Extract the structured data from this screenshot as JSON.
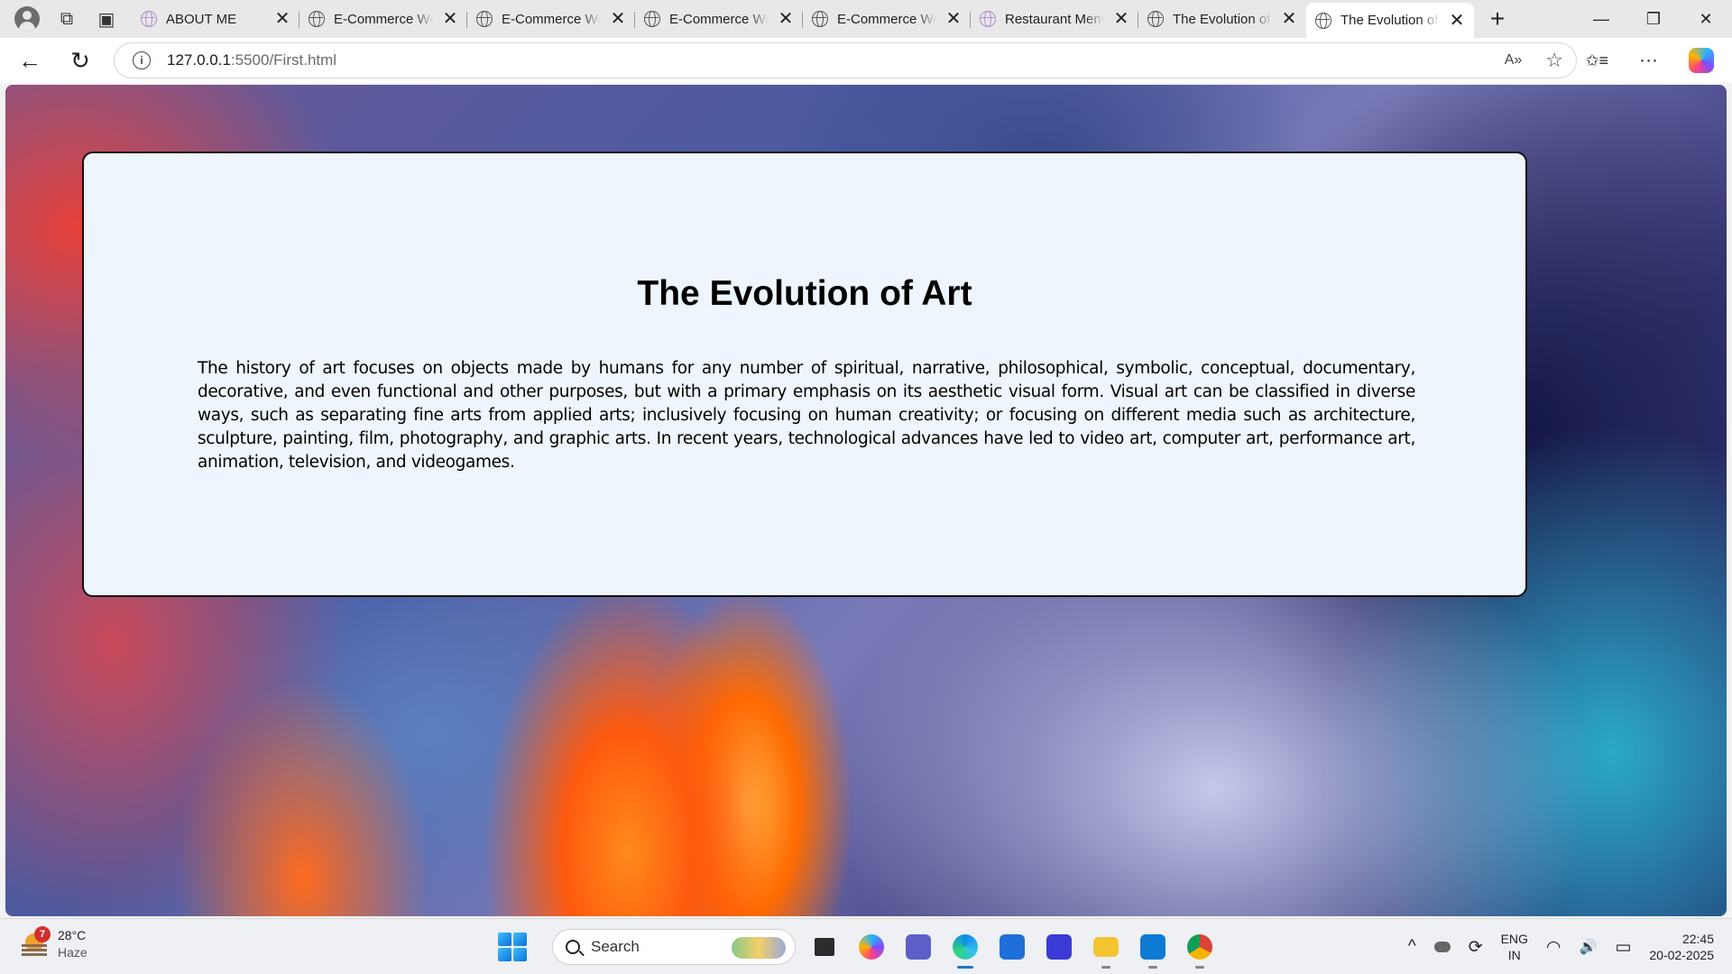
{
  "browser": {
    "tabs": [
      {
        "title": "ABOUT ME",
        "icon": "code-icon",
        "active": false
      },
      {
        "title": "E-Commerce Website",
        "icon": "globe-icon",
        "active": false
      },
      {
        "title": "E-Commerce Website",
        "icon": "globe-icon",
        "active": false
      },
      {
        "title": "E-Commerce Website",
        "icon": "globe-icon",
        "active": false
      },
      {
        "title": "E-Commerce Website",
        "icon": "globe-icon",
        "active": false
      },
      {
        "title": "Restaurant Menu",
        "icon": "code-icon",
        "active": false
      },
      {
        "title": "The Evolution of Art",
        "icon": "globe-icon",
        "active": false
      },
      {
        "title": "The Evolution of Art",
        "icon": "globe-icon",
        "active": true
      }
    ],
    "close_glyph": "✕",
    "new_tab_glyph": "+",
    "window_controls": {
      "minimize": "—",
      "restore": "❐",
      "close": "✕"
    },
    "nav": {
      "back": "←",
      "refresh": "↻"
    },
    "url_host": "127.0.0.1",
    "url_path": ":5500/First.html",
    "omnibox_icons": {
      "read_aloud": "A»",
      "favorite": "☆"
    },
    "toolbar_icons": {
      "favorites": "✩≡",
      "more": "···"
    }
  },
  "page": {
    "heading": "The Evolution of Art",
    "paragraph": "The history of art focuses on objects made by humans for any number of spiritual, narrative, philosophical, symbolic, conceptual, documentary, decorative, and even functional and other purposes, but with a primary emphasis on its aesthetic visual form. Visual art can be classified in diverse ways, such as separating fine arts from applied arts; inclusively focusing on human creativity; or focusing on different media such as architecture, sculpture, painting, film, photography, and graphic arts. In recent years, technological advances have led to video art, computer art, performance art, animation, television, and videogames."
  },
  "taskbar": {
    "weather": {
      "temp": "28°C",
      "condition": "Haze",
      "badge": "7"
    },
    "search_placeholder": "Search",
    "apps": [
      {
        "name": "task-view",
        "color": "#2b2b2b"
      },
      {
        "name": "copilot",
        "color": "#7c4dff"
      },
      {
        "name": "teams",
        "color": "#5b5fc7"
      },
      {
        "name": "edge",
        "color": "#0c8ce9",
        "active": true
      },
      {
        "name": "microsoft-store",
        "color": "#1e6fd9"
      },
      {
        "name": "code-editor",
        "color": "#3a3ad6"
      },
      {
        "name": "file-explorer",
        "color": "#f4c430"
      },
      {
        "name": "vscode",
        "color": "#0e7ad3"
      },
      {
        "name": "chrome",
        "color": "#db4437"
      }
    ],
    "tray": {
      "chevron": "^",
      "lang_line1": "ENG",
      "lang_line2": "IN",
      "wifi": "◠",
      "volume": "🔊",
      "battery": "▭"
    },
    "clock": {
      "time": "22:45",
      "date": "20-02-2025"
    }
  }
}
